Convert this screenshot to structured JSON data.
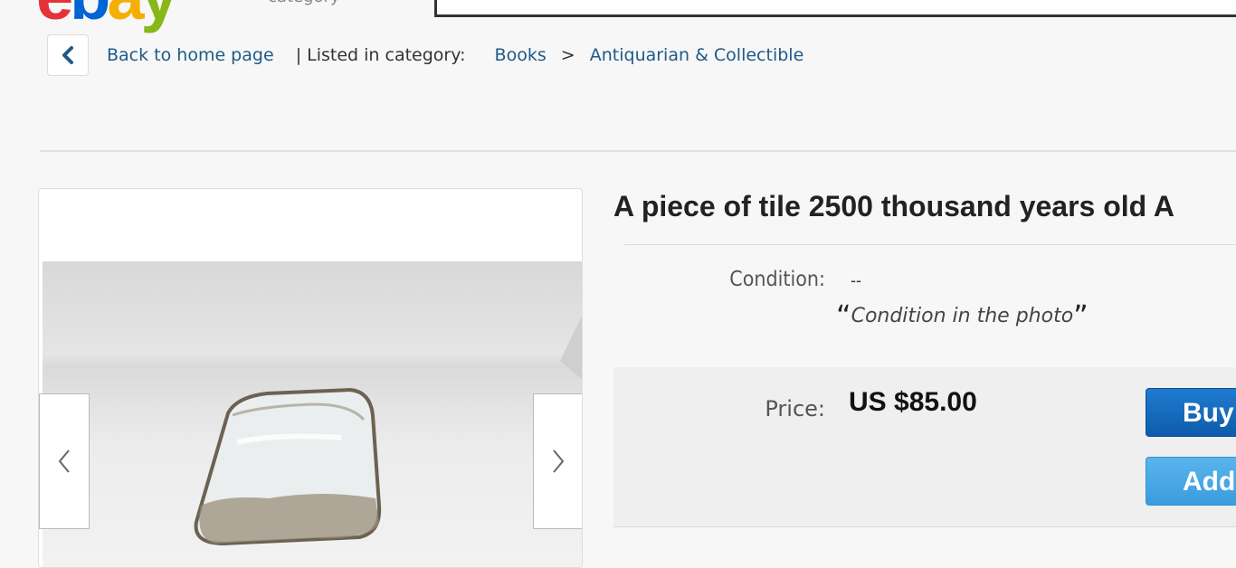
{
  "header": {
    "logo_letters": [
      {
        "char": "e",
        "color": "#e53238"
      },
      {
        "char": "b",
        "color": "#0064d2"
      },
      {
        "char": "a",
        "color": "#f5af02"
      },
      {
        "char": "y",
        "color": "#86b817"
      }
    ],
    "shop_by_category": "category"
  },
  "breadcrumb": {
    "back_label": "Back to home page",
    "listed_in": "| Listed in category:",
    "category_1": "Books",
    "separator": ">",
    "category_2": "Antiquarian & Collectible"
  },
  "item": {
    "title": "A piece of tile 2500 thousand years old A",
    "condition_label": "Condition:",
    "condition_value": "--",
    "condition_note": "Condition in the photo",
    "price_label": "Price:",
    "price_value": "US $85.00",
    "buy_label": "Buy",
    "add_label": "Add"
  },
  "colors": {
    "link": "#1f5a86",
    "buy_button": "#0e5cab",
    "add_button": "#3a9cde"
  }
}
